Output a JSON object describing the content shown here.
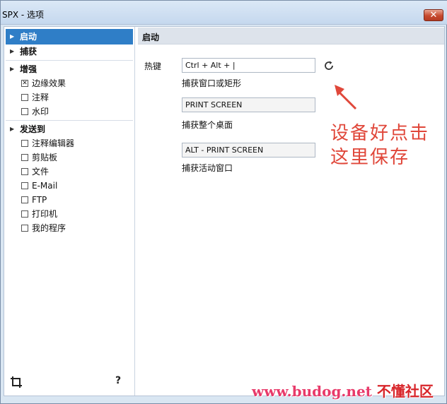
{
  "window": {
    "title": "SPX - 选项",
    "close_glyph": "✕"
  },
  "sidebar": {
    "sections": [
      {
        "label": "启动",
        "selected": true,
        "children": []
      },
      {
        "label": "捕获",
        "selected": false,
        "children": []
      },
      {
        "label": "增强",
        "selected": false,
        "children": [
          {
            "label": "边缘效果",
            "checked": true
          },
          {
            "label": "注释",
            "checked": false
          },
          {
            "label": "水印",
            "checked": false
          }
        ]
      },
      {
        "label": "发送到",
        "selected": false,
        "children": [
          {
            "label": "注释编辑器",
            "checked": false
          },
          {
            "label": "剪贴板",
            "checked": false
          },
          {
            "label": "文件",
            "checked": false
          },
          {
            "label": "E-Mail",
            "checked": false
          },
          {
            "label": "FTP",
            "checked": false
          },
          {
            "label": "打印机",
            "checked": false
          },
          {
            "label": "我的程序",
            "checked": false
          }
        ]
      }
    ],
    "footer": {
      "crop_icon": "crop-icon",
      "help_label": "?"
    }
  },
  "content": {
    "title": "启动",
    "hotkey_label": "热键",
    "hotkeys": [
      {
        "value": "Ctrl + Alt + |",
        "caption": "捕获窗口或矩形",
        "active": true
      },
      {
        "value": "PRINT SCREEN",
        "caption": "捕获整个桌面",
        "active": false
      },
      {
        "value": "ALT - PRINT SCREEN",
        "caption": "捕获活动窗口",
        "active": false
      }
    ],
    "reset_icon": "refresh-icon"
  },
  "annotation": {
    "line1": "设备好点击",
    "line2": "这里保存",
    "color": "#e0473a"
  },
  "watermark": {
    "url": "www.budog.net",
    "brand": "不懂社区"
  }
}
